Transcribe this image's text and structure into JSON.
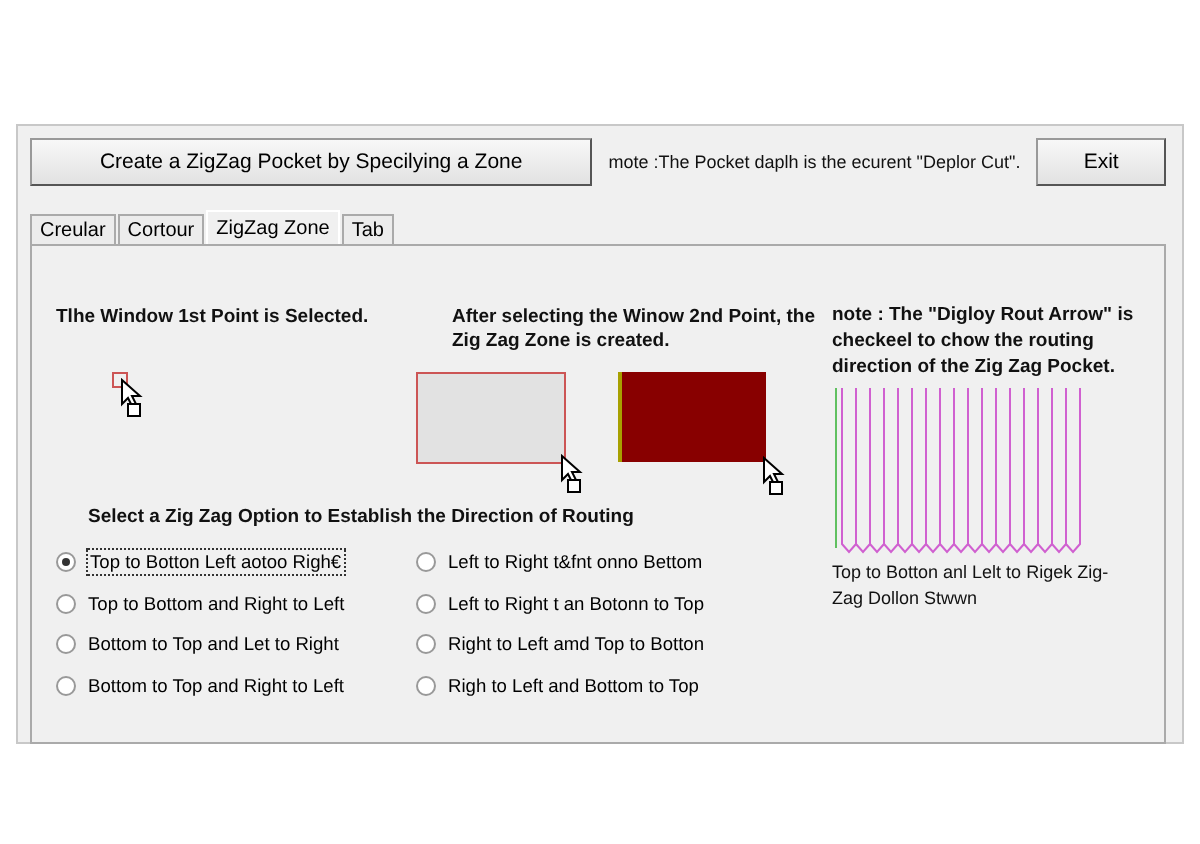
{
  "toolbar": {
    "create_button": "Create a ZigZag Pocket by Specilying a Zone",
    "note": "mote :The Pocket daplh is the ecurent  \"Deplor Cut\".",
    "exit_button": "Exit"
  },
  "tabs": [
    {
      "label": "Creular",
      "selected": false
    },
    {
      "label": "Cortour",
      "selected": false
    },
    {
      "label": "ZigZag Zone",
      "selected": true
    },
    {
      "label": "Tab",
      "selected": false
    }
  ],
  "steps": [
    {
      "caption": "Tlhe Window 1st Point is Selected."
    },
    {
      "caption": "After selecting the Winow 2nd Point, the Zig Zag Zone is created."
    }
  ],
  "options": {
    "heading": "Select a Zig Zag Option to Establish the Direction of Routing",
    "items": [
      {
        "label": "Top to Botton Left aotoo Righ€",
        "selected": true
      },
      {
        "label": "Top to Bottom and Right to Left",
        "selected": false
      },
      {
        "label": "Bottom to Top and Let to Right",
        "selected": false
      },
      {
        "label": "Bottom to Top and Right to Left",
        "selected": false
      },
      {
        "label": "Left to Right t&fnt onno Bettom",
        "selected": false
      },
      {
        "label": "Left to Right t an Botonn to Top",
        "selected": false
      },
      {
        "label": "Right to Left amd Top to Botton",
        "selected": false
      },
      {
        "label": "Righ to Left and Bottom to Top",
        "selected": false
      }
    ]
  },
  "note": {
    "text": "note : The \"Digloy Rout Arrow\" is checkeel to chow the routing direction of the Zig Zag Pocket.",
    "caption": "Top to Botton anl Lelt to Rigek Zig-Zag Dollon Stwwn"
  }
}
